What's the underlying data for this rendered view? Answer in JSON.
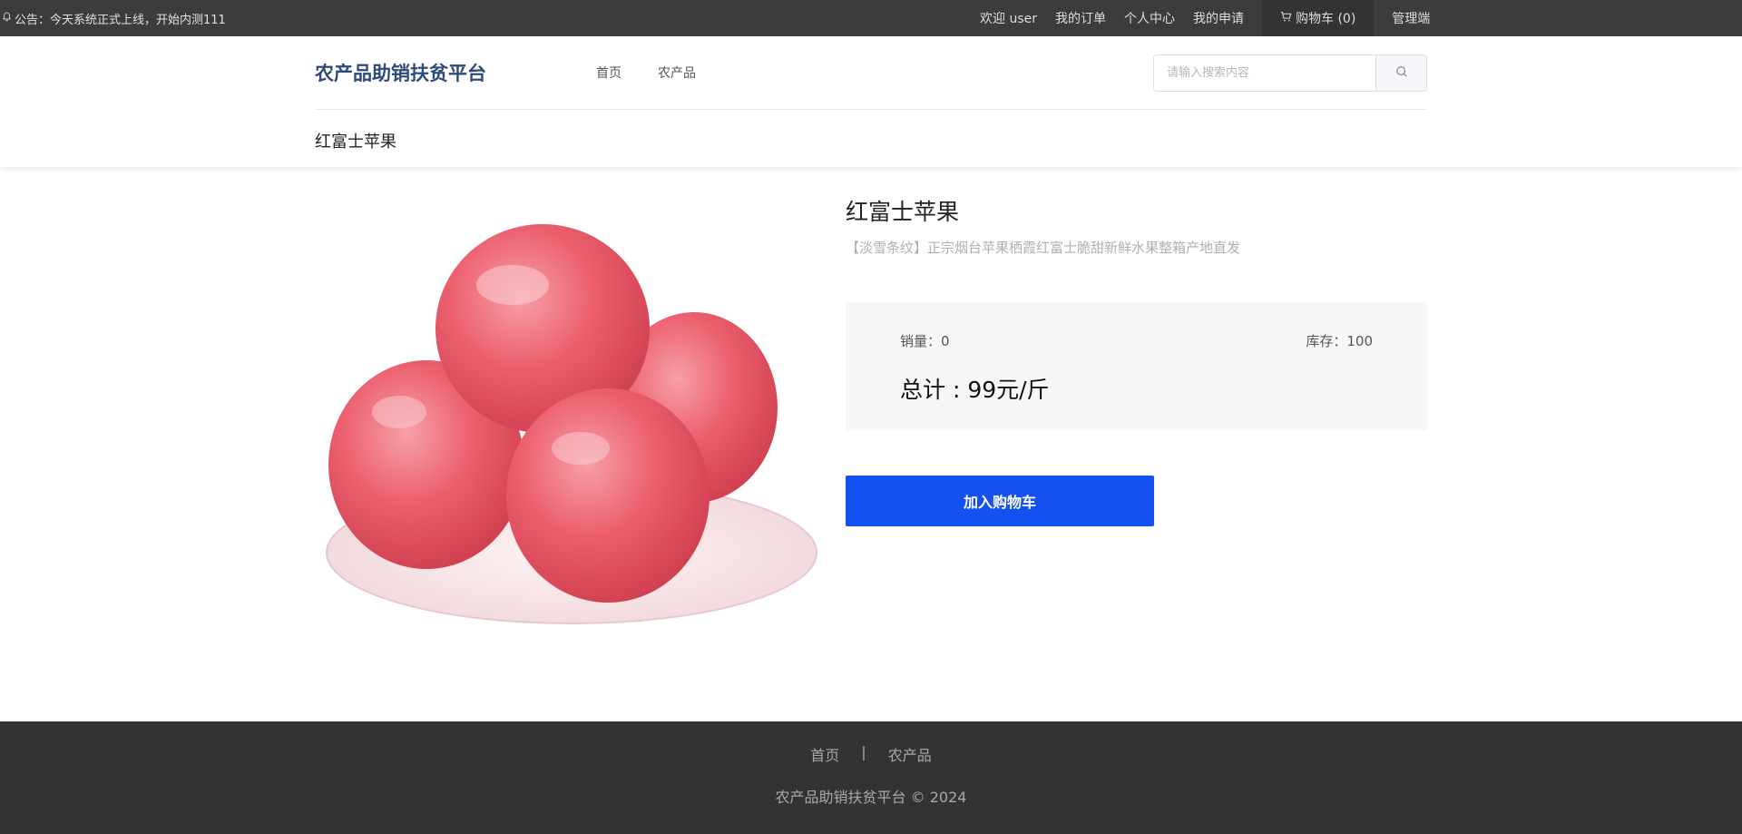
{
  "topbar": {
    "notice": "公告：今天系统正式上线，开始内测111",
    "welcome": "欢迎 user",
    "nav": [
      "我的订单",
      "个人中心",
      "我的申请"
    ],
    "cart_label": "购物车 (0)",
    "admin_label": "管理端"
  },
  "header": {
    "logo": "农产品助销扶贫平台",
    "nav": [
      "首页",
      "农产品"
    ],
    "search_placeholder": "请输入搜索内容",
    "breadcrumb": "红富士苹果"
  },
  "product": {
    "title": "红富士苹果",
    "subtitle": "【淡雪条纹】正宗烟台苹果栖霞红富士脆甜新鲜水果整箱产地直发",
    "sales_label": "销量：0",
    "stock_label": "库存：100",
    "total": "总计 : 99元/斤",
    "add_to_cart": "加入购物车"
  },
  "footer": {
    "links": [
      "首页",
      "农产品"
    ],
    "separator": "|",
    "copyright": "农产品助销扶贫平台 © 2024"
  },
  "colors": {
    "topbar_bg": "#3c3c3c",
    "logo": "#2e4a78",
    "primary_button": "#1550f0",
    "footer_bg": "#333333"
  }
}
